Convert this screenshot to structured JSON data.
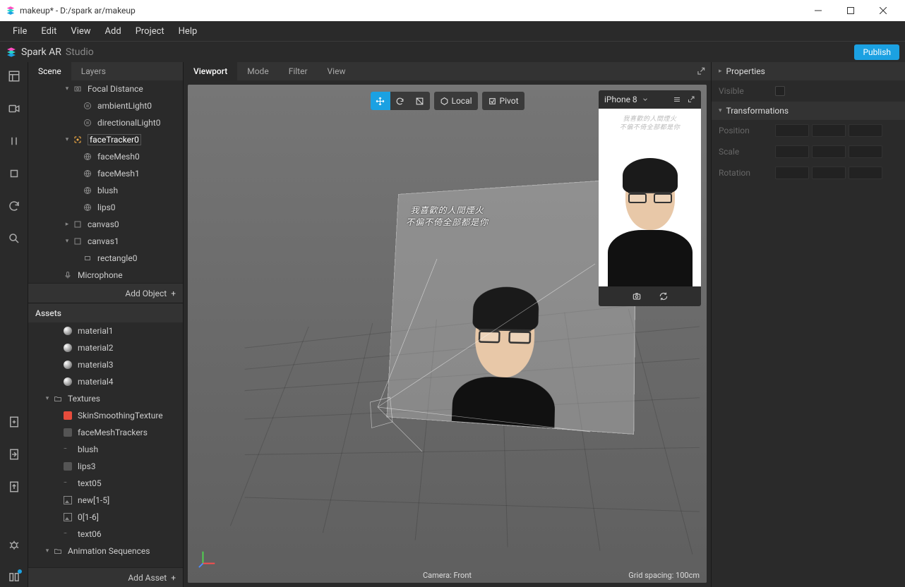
{
  "window": {
    "title": "makeup* - D:/spark ar/makeup",
    "app_name": "Spark AR",
    "app_suffix": "Studio"
  },
  "menu": [
    "File",
    "Edit",
    "View",
    "Add",
    "Project",
    "Help"
  ],
  "publish_label": "Publish",
  "side_tabs": {
    "scene": "Scene",
    "layers": "Layers"
  },
  "scene_tree": [
    {
      "indent": 3,
      "expand": "▾",
      "icon": "focal",
      "label": "Focal Distance"
    },
    {
      "indent": 4,
      "expand": "",
      "icon": "light",
      "label": "ambientLight0"
    },
    {
      "indent": 4,
      "expand": "",
      "icon": "light",
      "label": "directionalLight0"
    },
    {
      "indent": 3,
      "expand": "▾",
      "icon": "tracker",
      "label": "faceTracker0",
      "selected": true
    },
    {
      "indent": 4,
      "expand": "",
      "icon": "mesh",
      "label": "faceMesh0"
    },
    {
      "indent": 4,
      "expand": "",
      "icon": "mesh",
      "label": "faceMesh1"
    },
    {
      "indent": 4,
      "expand": "",
      "icon": "mesh",
      "label": "blush"
    },
    {
      "indent": 4,
      "expand": "",
      "icon": "mesh",
      "label": "lips0"
    },
    {
      "indent": 3,
      "expand": "▸",
      "icon": "canvas",
      "label": "canvas0"
    },
    {
      "indent": 3,
      "expand": "▾",
      "icon": "canvas",
      "label": "canvas1"
    },
    {
      "indent": 4,
      "expand": "",
      "icon": "rect",
      "label": "rectangle0"
    },
    {
      "indent": 2,
      "expand": "",
      "icon": "mic",
      "label": "Microphone"
    }
  ],
  "add_object": "Add Object",
  "assets_header": "Assets",
  "assets_tree": [
    {
      "indent": 1,
      "expand": "",
      "icon": "sphere",
      "label": "material1"
    },
    {
      "indent": 1,
      "expand": "",
      "icon": "sphere",
      "label": "material2"
    },
    {
      "indent": 1,
      "expand": "",
      "icon": "sphere",
      "label": "material3"
    },
    {
      "indent": 1,
      "expand": "",
      "icon": "sphere",
      "label": "material4"
    },
    {
      "indent": 0,
      "expand": "▾",
      "icon": "folder",
      "label": "Textures"
    },
    {
      "indent": 1,
      "expand": "",
      "icon": "red",
      "label": "SkinSmoothingTexture"
    },
    {
      "indent": 1,
      "expand": "",
      "icon": "blank",
      "label": "faceMeshTrackers"
    },
    {
      "indent": 1,
      "expand": "",
      "icon": "txt",
      "label": "blush"
    },
    {
      "indent": 1,
      "expand": "",
      "icon": "blank",
      "label": "lips3"
    },
    {
      "indent": 1,
      "expand": "",
      "icon": "txt",
      "label": "text05"
    },
    {
      "indent": 1,
      "expand": "",
      "icon": "img",
      "label": "new[1-5]"
    },
    {
      "indent": 1,
      "expand": "",
      "icon": "img",
      "label": "0[1-6]"
    },
    {
      "indent": 1,
      "expand": "",
      "icon": "txt",
      "label": "text06"
    },
    {
      "indent": 0,
      "expand": "▾",
      "icon": "folder",
      "label": "Animation Sequences"
    }
  ],
  "add_asset": "Add Asset",
  "viewport_tabs": {
    "viewport": "Viewport",
    "mode": "Mode",
    "filter": "Filter",
    "view": "View"
  },
  "viewport_toolbar": {
    "local": "Local",
    "pivot": "Pivot"
  },
  "device_name": "iPhone 8",
  "viewport_overlay_text": [
    "我喜歡的人間煙火",
    "不偏不倚全部都是你"
  ],
  "vp_status": {
    "center": "Camera: Front",
    "right": "Grid spacing: 100cm"
  },
  "properties": {
    "title": "Properties",
    "visible": "Visible",
    "transformations": "Transformations",
    "position": "Position",
    "scale": "Scale",
    "rotation": "Rotation"
  }
}
